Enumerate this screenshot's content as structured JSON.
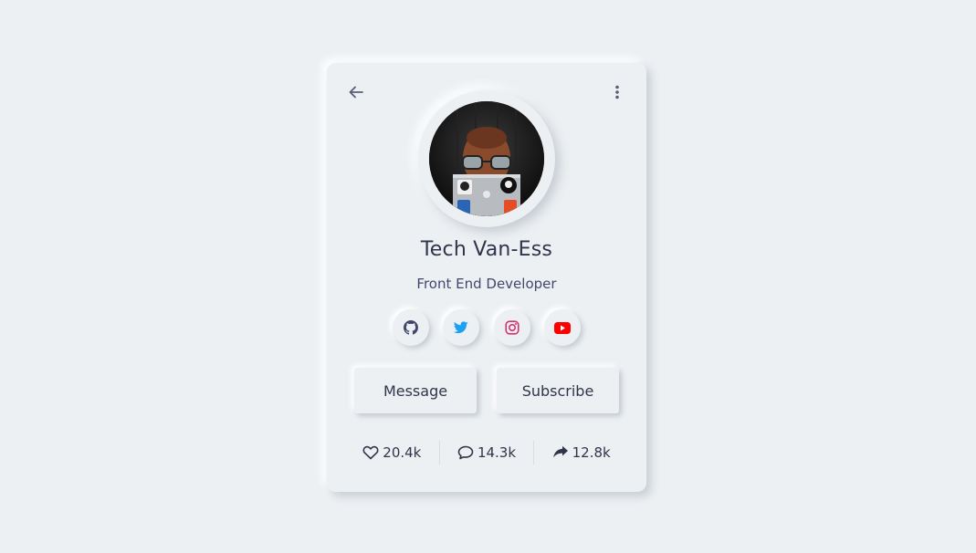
{
  "profile": {
    "name": "Tech Van-Ess",
    "role": "Front End Developer"
  },
  "socials": [
    {
      "name": "github",
      "icon": "github-icon",
      "color": "#44476a"
    },
    {
      "name": "twitter",
      "icon": "twitter-icon",
      "color": "#1da1f2"
    },
    {
      "name": "instagram",
      "icon": "instagram-icon",
      "color": "#e1306c"
    },
    {
      "name": "youtube",
      "icon": "youtube-icon",
      "color": "#ff0000"
    }
  ],
  "buttons": {
    "message": "Message",
    "subscribe": "Subscribe"
  },
  "stats": {
    "likes": "20.4k",
    "comments": "14.3k",
    "shares": "12.8k"
  },
  "colors": {
    "background": "#ecf0f3",
    "text": "#31344b"
  }
}
